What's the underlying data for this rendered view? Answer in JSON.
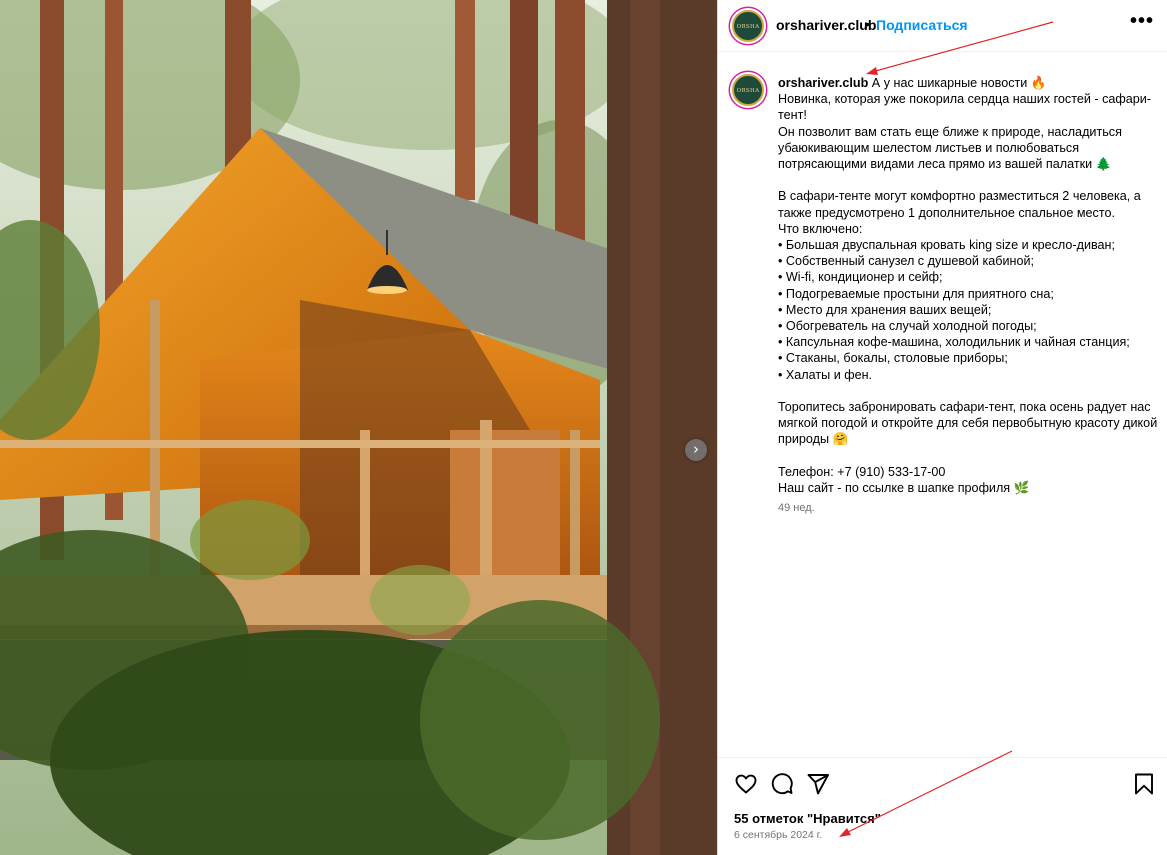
{
  "post": {
    "username": "orshariver.club",
    "avatar_text": "ORSHA",
    "follow_label": "Подписаться",
    "separator": "•",
    "more_label": "•••",
    "caption_lines": [
      "А у нас шикарные новости 🔥",
      "Новинка, которая уже покорила сердца наших гостей - сафари-тент!",
      "Он позволит вам стать еще ближе к природе, насладиться убаюкивающим шелестом листьев и полюбоваться потрясающими видами леса прямо из вашей палатки 🌲",
      "",
      "В сафари-тенте могут комфортно разместиться 2 человека, а также предусмотрено 1 дополнительное спальное место.",
      "Что включено:",
      "• Большая двуспальная кровать king size и кресло-диван;",
      "• Собственный санузел с душевой кабиной;",
      "• Wi-fi, кондиционер и сейф;",
      "• Подогреваемые простыни для приятного сна;",
      "• Место для хранения ваших вещей;",
      "• Обогреватель на случай холодной погоды;",
      "• Капсульная кофе-машина, холодильник и чайная станция;",
      "• Стаканы, бокалы, столовые приборы;",
      "• Халаты и фен.",
      "",
      "Торопитесь забронировать сафари-тент, пока осень радует нас мягкой погодой и откройте для себя первобытную красоту дикой природы 🤗",
      "",
      "Телефон: +7 (910) 533-17-00",
      "Наш сайт - по ссылке в шапке профиля 🌿"
    ],
    "time_ago": "49 нед.",
    "likes_text": "55 отметок \"Нравится\"",
    "date_text": "6 сентябрь 2024 г.",
    "next_label": "›"
  },
  "icons": {
    "like": "heart-icon",
    "comment": "comment-icon",
    "share": "share-icon",
    "save": "bookmark-icon",
    "next": "chevron-right-icon"
  },
  "colors": {
    "accent": "#0095f6",
    "annotation": "#e0262a",
    "muted": "#737373"
  }
}
